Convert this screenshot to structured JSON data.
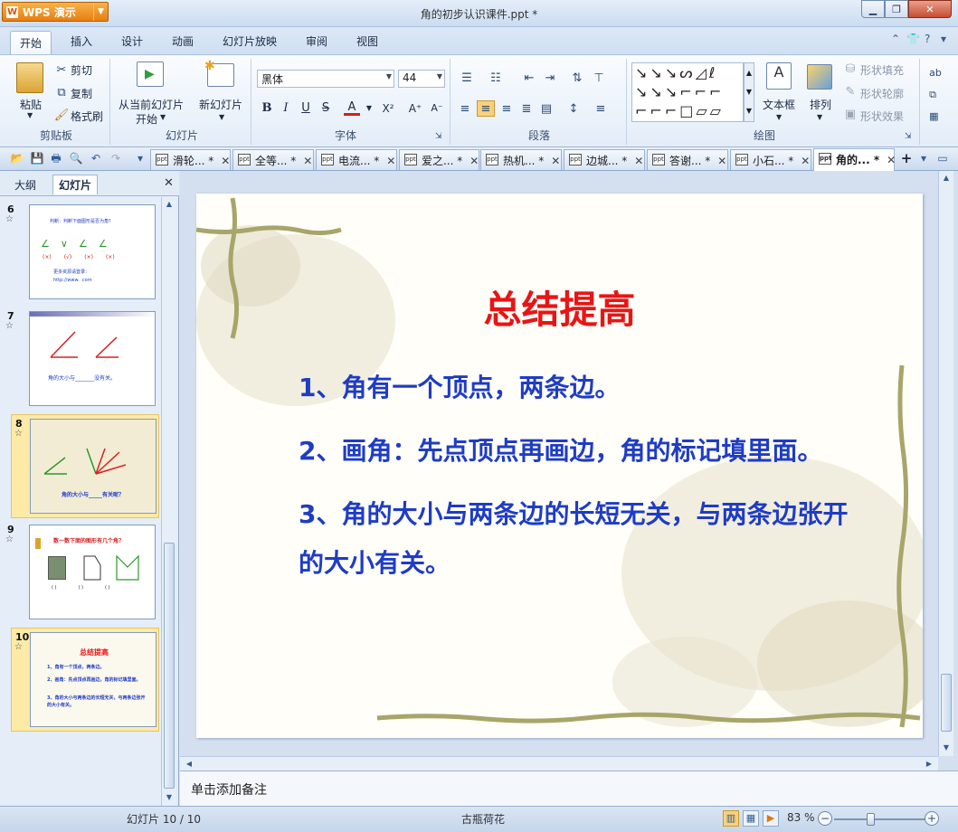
{
  "app": {
    "menu_button": "WPS 演示",
    "doc_title": "角的初步认识课件.ppt *"
  },
  "menu": {
    "tabs": [
      "开始",
      "插入",
      "设计",
      "动画",
      "幻灯片放映",
      "审阅",
      "视图"
    ],
    "active": "开始"
  },
  "ribbon": {
    "clipboard": {
      "paste": "粘贴",
      "cut": "剪切",
      "copy": "复制",
      "format_painter": "格式刷",
      "label": "剪贴板"
    },
    "slides": {
      "from_current_line1": "从当前幻灯片",
      "from_current_line2": "开始",
      "new_slide": "新幻灯片",
      "label": "幻灯片"
    },
    "font": {
      "name": "黑体",
      "size": "44",
      "label": "字体",
      "bold": "B",
      "italic": "I",
      "underline": "U",
      "strike": "S",
      "color": "A",
      "superscript": "X²",
      "grow": "A⁺",
      "shrink": "A⁻"
    },
    "paragraph": {
      "label": "段落"
    },
    "drawing": {
      "textbox": "文本框",
      "arrange": "排列",
      "fill": "形状填充",
      "outline": "形状轮廓",
      "effects": "形状效果",
      "label": "绘图"
    }
  },
  "doc_tabs": [
    {
      "label": "滑轮... *",
      "active": false
    },
    {
      "label": "全等... *",
      "active": false
    },
    {
      "label": "电流... *",
      "active": false
    },
    {
      "label": "爱之... *",
      "active": false
    },
    {
      "label": "热机... *",
      "active": false
    },
    {
      "label": "边城... *",
      "active": false
    },
    {
      "label": "答谢... *",
      "active": false
    },
    {
      "label": "小石... *",
      "active": false
    },
    {
      "label": "角的... *",
      "active": true
    }
  ],
  "panel": {
    "tab_outline": "大纲",
    "tab_slides": "幻灯片",
    "thumbnails": [
      {
        "num": "6",
        "title": "判断：判断下面图形是否为角？",
        "marks": [
          "(×)",
          "(√)",
          "(×)",
          "(×)"
        ],
        "footer_line1": "更多资源请登录：",
        "footer_line2": "http://www.    .com",
        "selected": false
      },
      {
        "num": "7",
        "caption": "角的大小与_______没有关。",
        "selected": false
      },
      {
        "num": "8",
        "caption": "角的大小与_____有关呢？",
        "selected": true
      },
      {
        "num": "9",
        "title": "数一数下面的图形有几个角？",
        "marks": [
          "(   )",
          "(   )",
          "(   )"
        ],
        "selected": false
      },
      {
        "num": "10",
        "title": "总结提高",
        "lines": [
          "1、角有一个顶点，两条边。",
          "2、画角：先点顶点再画边，角的标记填里面。",
          "3、角的大小与两条边的长短无关，与两条边张开的大小有关。"
        ],
        "selected": true
      }
    ]
  },
  "slide": {
    "title": "总结提高",
    "points": [
      "1、角有一个顶点，两条边。",
      "2、画角：先点顶点再画边，角的标记填里面。",
      "3、角的大小与两条边的长短无关，与两条边张开的大小有关。"
    ],
    "title_color": "#e81515",
    "body_color": "#1f3cc5"
  },
  "notes_placeholder": "单击添加备注",
  "status": {
    "slide_counter": "幻灯片 10 / 10",
    "theme": "古瓶荷花",
    "zoom": "83 %",
    "zoom_value": 83
  },
  "colors": {
    "accent_orange": "#e77f10",
    "ribbon_blue": "#d6e4f3"
  }
}
